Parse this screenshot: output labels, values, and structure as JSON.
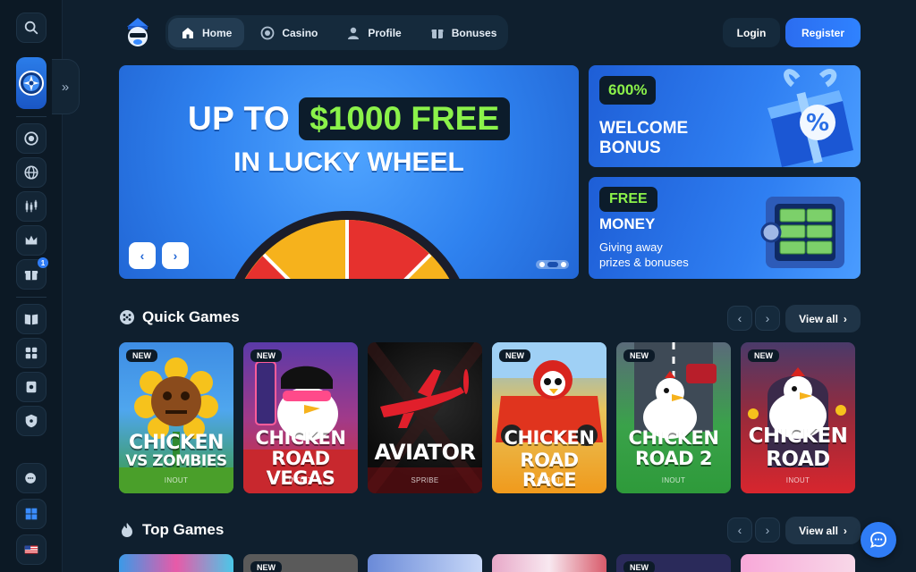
{
  "nav": {
    "items": [
      {
        "label": "Home",
        "icon": "home-icon",
        "active": true
      },
      {
        "label": "Casino",
        "icon": "casino-chip-icon",
        "active": false
      },
      {
        "label": "Profile",
        "icon": "user-icon",
        "active": false
      },
      {
        "label": "Bonuses",
        "icon": "gift-icon",
        "active": false
      }
    ]
  },
  "auth": {
    "login": "Login",
    "register": "Register"
  },
  "sidebar": {
    "gift_badge": "1"
  },
  "hero": {
    "line1_prefix": "UP TO",
    "line1_highlight": "$1000 FREE",
    "line2": "IN LUCKY WHEEL",
    "prev": "‹",
    "next": "›"
  },
  "promos": [
    {
      "pill": "600%",
      "title_line1": "WELCOME",
      "title_line2": "BONUS"
    },
    {
      "pill": "FREE",
      "title": "MONEY",
      "sub_line1": "Giving away",
      "sub_line2": "prizes & bonuses"
    }
  ],
  "quick_games": {
    "title": "Quick Games",
    "view_all": "View all",
    "games": [
      {
        "name_line1": "CHICKEN",
        "name_line2": "VS ZOMBIES",
        "provider": "INOUT",
        "new": "NEW"
      },
      {
        "name_line1": "CHICKEN",
        "name_line2": "ROAD VEGAS",
        "provider": "INOUT",
        "new": "NEW"
      },
      {
        "name_line1": "AVIATOR",
        "name_line2": "",
        "provider": "SPRIBE",
        "new": ""
      },
      {
        "name_line1": "CHICKEN",
        "name_line2": "ROAD RACE",
        "provider": "INOUT",
        "new": "NEW"
      },
      {
        "name_line1": "CHICKEN",
        "name_line2": "ROAD 2",
        "provider": "INOUT",
        "new": "NEW"
      },
      {
        "name_line1": "CHICKEN",
        "name_line2": "ROAD",
        "provider": "INOUT",
        "new": "NEW"
      }
    ]
  },
  "top_games": {
    "title": "Top Games",
    "view_all": "View all",
    "badges": [
      "",
      "NEW",
      "",
      "",
      "NEW",
      ""
    ]
  },
  "colors": {
    "background": "#0f1f2e",
    "accent": "#2f7cf6",
    "highlight": "#8bf24a"
  }
}
